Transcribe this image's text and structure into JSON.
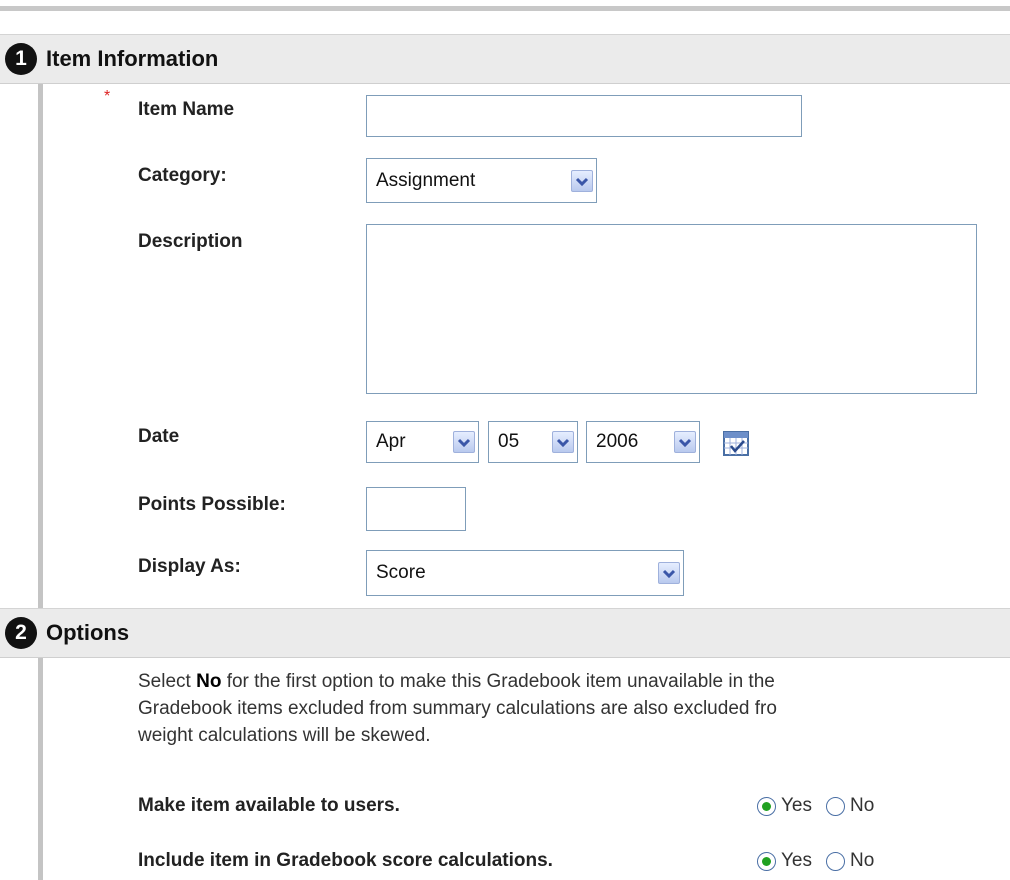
{
  "section1": {
    "number": "1",
    "title": "Item Information",
    "required_marker": "*",
    "item_name": {
      "label": "Item Name",
      "value": ""
    },
    "category": {
      "label": "Category:",
      "value": "Assignment"
    },
    "description": {
      "label": "Description",
      "value": ""
    },
    "date": {
      "label": "Date",
      "month": "Apr",
      "day": "05",
      "year": "2006",
      "calendar_icon": "calendar-icon"
    },
    "points": {
      "label": "Points Possible:",
      "value": ""
    },
    "display_as": {
      "label": "Display As:",
      "value": "Score"
    }
  },
  "section2": {
    "number": "2",
    "title": "Options",
    "para_line1_prefix": "Select ",
    "para_line1_bold": "No",
    "para_line1_suffix": " for the first option to make this Gradebook item unavailable in the",
    "para_line2": "Gradebook items excluded from summary calculations are also excluded fro",
    "para_line3": "weight calculations will be skewed.",
    "available": {
      "label": "Make item available to users.",
      "yes": "Yes",
      "no": "No",
      "selected": "Yes"
    },
    "include": {
      "label": "Include item in Gradebook score calculations.",
      "yes": "Yes",
      "no": "No",
      "selected": "Yes"
    }
  },
  "colors": {
    "header_bg": "#ebebeb",
    "left_bar": "#c4c4c4",
    "input_border": "#7f9db9",
    "radio_selected": "#21a121",
    "required": "#d22222"
  }
}
